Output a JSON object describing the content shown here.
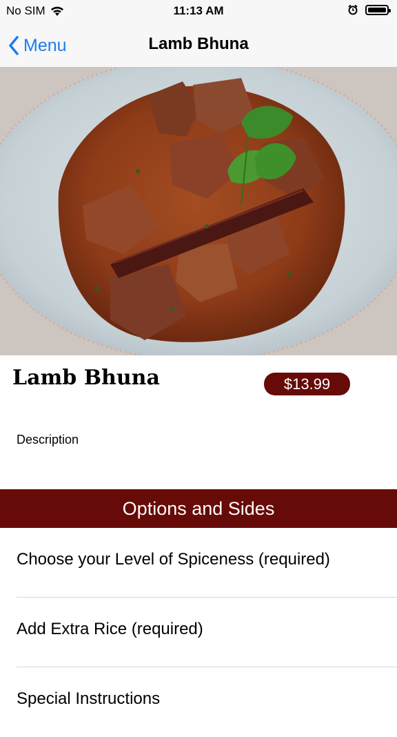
{
  "status_bar": {
    "carrier": "No SIM",
    "time": "11:13 AM"
  },
  "nav": {
    "back_label": "Menu",
    "title": "Lamb Bhuna"
  },
  "item": {
    "name": "Lamb Bhuna",
    "price": "$13.99",
    "description_label": "Description"
  },
  "section": {
    "title": "Options and Sides"
  },
  "options": [
    {
      "label": "Choose your Level of Spiceness (required)"
    },
    {
      "label": "Add Extra Rice (required)"
    },
    {
      "label": "Special Instructions"
    }
  ],
  "colors": {
    "accent": "#670b08",
    "link": "#1a7cf2"
  }
}
